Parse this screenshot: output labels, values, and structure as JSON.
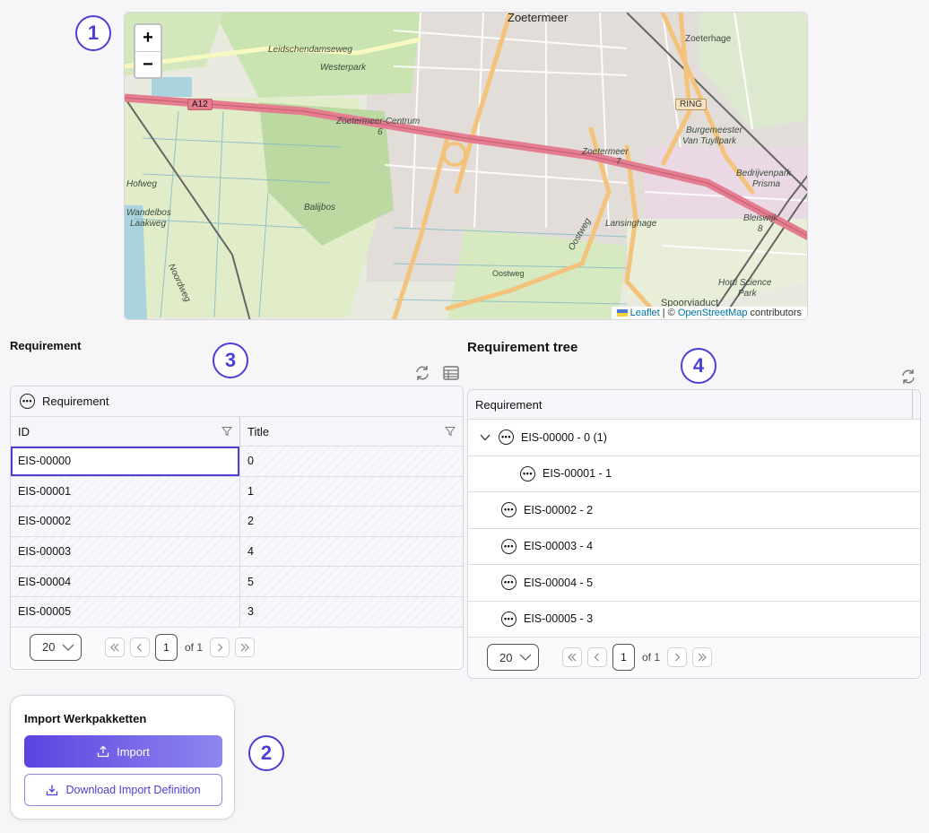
{
  "annotations": [
    "1",
    "2",
    "3",
    "4"
  ],
  "map": {
    "zoom_in": "+",
    "zoom_out": "−",
    "labels": {
      "city": "Zoetermeer",
      "centrum": "Zoetermeer-Centrum",
      "centrum_num": "6",
      "station": "Zoetermeer",
      "station_num": "7",
      "bleiswijk": "Bleiswijk",
      "bleiswijk_num": "8",
      "westerpark": "Westerpark",
      "ballijbos": "Balijbos",
      "wandelbos": "Wandelbos",
      "laakweg": "Laakweg",
      "hofweg": "Hofweg",
      "burgemeester": "Burgemeester",
      "vantuyll": "Van Tuyllpark",
      "bedrijvenpark": "Bedrijvenpark",
      "prisma": "Prisma",
      "lansinghage": "Lansinghage",
      "oostweg": "Oostweg",
      "oostweg2": "Oostweg",
      "horti": "Horti Science",
      "park": "Park",
      "spoorviaduct": "Spoorviaduct",
      "zoeterhage": "Zoeterhage",
      "noordweg": "Noordweg",
      "leidsch": "Leidschendamseweg"
    },
    "signs": {
      "a12": "A12",
      "ring": "RING"
    },
    "attribution": {
      "leaflet": "Leaflet",
      "sep": " | © ",
      "osm": "OpenStreetMap",
      "suffix": " contributors"
    }
  },
  "requirement": {
    "section_title": "Requirement",
    "panel_title": "Requirement",
    "columns": {
      "id": "ID",
      "title": "Title"
    },
    "rows": [
      {
        "id": "EIS-00000",
        "title": "0"
      },
      {
        "id": "EIS-00001",
        "title": "1"
      },
      {
        "id": "EIS-00002",
        "title": "2"
      },
      {
        "id": "EIS-00003",
        "title": "4"
      },
      {
        "id": "EIS-00004",
        "title": "5"
      },
      {
        "id": "EIS-00005",
        "title": "3"
      }
    ],
    "pager": {
      "page_size": "20",
      "current": "1",
      "of": "of 1"
    }
  },
  "tree": {
    "section_title": "Requirement tree",
    "column": "Requirement",
    "rows": [
      {
        "label": "EIS-00000 - 0 (1)",
        "level": 0,
        "expanded": true
      },
      {
        "label": "EIS-00001 - 1",
        "level": 1
      },
      {
        "label": "EIS-00002 - 2",
        "level": 0
      },
      {
        "label": "EIS-00003 - 4",
        "level": 0
      },
      {
        "label": "EIS-00004 - 5",
        "level": 0
      },
      {
        "label": "EIS-00005 - 3",
        "level": 0
      }
    ],
    "pager": {
      "page_size": "20",
      "current": "1",
      "of": "of 1"
    }
  },
  "import_card": {
    "title": "Import Werkpakketten",
    "import_label": "Import",
    "download_label": "Download Import Definition"
  },
  "colors": {
    "accent": "#4b3fd6",
    "highway": "#e57d91",
    "road": "#f3c37c",
    "water": "#aad3df",
    "green": "#cde6b4"
  }
}
